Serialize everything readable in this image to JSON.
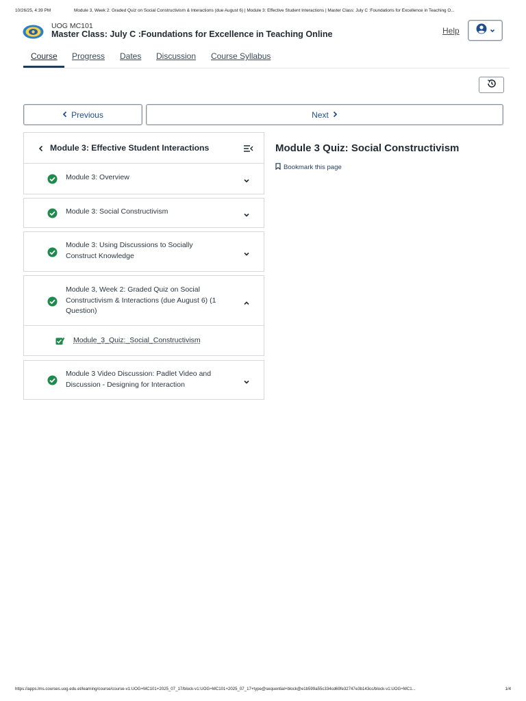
{
  "print": {
    "datetime": "10/26/25, 4:39 PM",
    "doc_title": "Module 3, Week 2: Graded Quiz on Social Constructivism & Interactions (due August 6) | Module 3: Effective Student Interactions | Master Class: July C :Foundations for Excellence in Teaching O...",
    "url": "https://apps.lms.courses.uog.edu.et/learning/course/course-v1:UOG+MC101+2025_07_17/block-v1:UOG+MC101+2025_07_17+type@sequential+block@e1b599a55c334cd69fe32747e3b143cc/block-v1:UOG+MC1...",
    "page": "1/4"
  },
  "header": {
    "course_code": "UOG MC101",
    "course_title": "Master Class: July C :Foundations for Excellence in Teaching Online",
    "help_label": "Help"
  },
  "tabs": [
    "Course",
    "Progress",
    "Dates",
    "Discussion",
    "Course Syllabus"
  ],
  "nav": {
    "previous_label": "Previous",
    "next_label": "Next"
  },
  "outline": {
    "title": "Module 3: Effective Student Interactions",
    "sections": [
      {
        "label": "Module 3: Overview",
        "expanded": false
      },
      {
        "label": "Module 3: Social Constructivism",
        "expanded": false
      },
      {
        "label": "Module 3: Using Discussions to Socially Construct Knowledge",
        "expanded": false
      },
      {
        "label": "Module 3, Week 2: Graded Quiz on Social Constructivism & Interactions (due August 6) (1 Question)",
        "expanded": true
      },
      {
        "label": "Module 3 Video Discussion: Padlet Video and Discussion - Designing for Interaction",
        "expanded": false
      }
    ],
    "subsection_label": "Module_3_Quiz:_Social_Constructivism"
  },
  "unit": {
    "title": "Module 3 Quiz: Social Constructivism",
    "bookmark_label": "Bookmark this page"
  },
  "colors": {
    "complete_green": "#1f8a4c",
    "link_blue": "#1f4e8a",
    "brand_dark": "#1f3b57"
  }
}
